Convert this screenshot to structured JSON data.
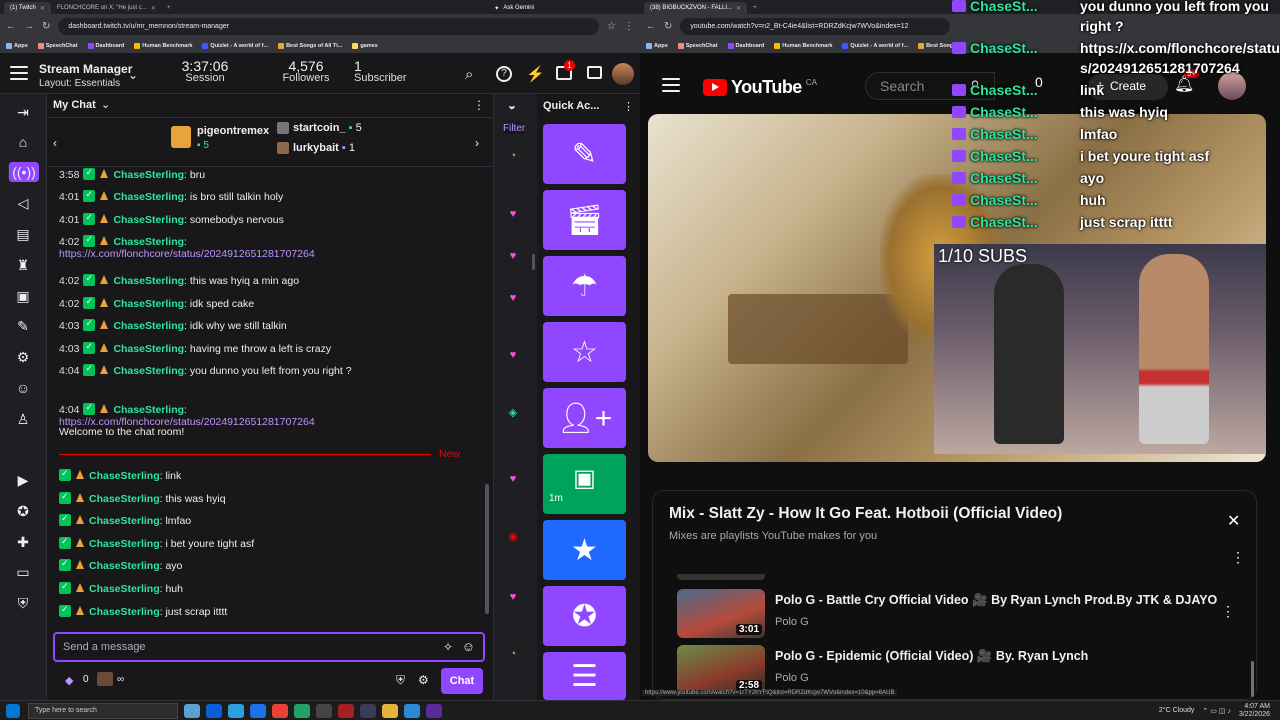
{
  "left_browser": {
    "tabs": [
      {
        "label": "(1) Twitch"
      },
      {
        "label": "FLONCHCORE on X: \"He just c..."
      }
    ],
    "ask_gemini": "Ask Gemini",
    "url": "dashboard.twitch.tv/u/mr_memnon/stream-manager",
    "bookmarks": [
      "Apps",
      "SpeechChat",
      "Dashboard",
      "Human Benchmark",
      "Quizlet - A world of f...",
      "Best Songs of All Ti...",
      "games"
    ]
  },
  "twitch": {
    "title": "Stream Manager",
    "layout": "Layout: Essentials",
    "session_value": "3:37:06",
    "session_label": "Session",
    "followers_value": "4,576",
    "followers_label": "Followers",
    "subs_value": "1",
    "subs_label": "Subscriber",
    "notif_count": "1",
    "chat_title": "My Chat",
    "gifters": [
      {
        "name": "pigeontremex",
        "count": "5"
      },
      {
        "name": "startcoin_",
        "count": "5"
      },
      {
        "name": "lurkybait",
        "count": "1"
      }
    ],
    "messages": [
      {
        "time": "3:58",
        "user": "ChaseSterling",
        "text": "bru"
      },
      {
        "time": "4:01",
        "user": "ChaseSterling",
        "text": "is bro still talkin holy"
      },
      {
        "time": "4:01",
        "user": "ChaseSterling",
        "text": "somebodys nervous"
      },
      {
        "time": "4:02",
        "user": "ChaseSterling",
        "text": "",
        "link": "https://x.com/flonchcore/status/2024912651281707264"
      },
      {
        "time": "4:02",
        "user": "ChaseSterling",
        "text": "this was hyiq a min ago"
      },
      {
        "time": "4:02",
        "user": "ChaseSterling",
        "text": "idk sped cake"
      },
      {
        "time": "4:03",
        "user": "ChaseSterling",
        "text": "idk why we still talkin"
      },
      {
        "time": "4:03",
        "user": "ChaseSterling",
        "text": "having me throw a left is crazy"
      },
      {
        "time": "4:04",
        "user": "ChaseSterling",
        "text": "you dunno you left from you right ?"
      },
      {
        "time": "4:04",
        "user": "ChaseSterling",
        "text": "",
        "link": "https://x.com/flonchcore/status/2024912651281707264"
      }
    ],
    "welcome": "Welcome to the chat room!",
    "new_label": "New",
    "new_messages": [
      {
        "user": "ChaseSterling",
        "text": "link"
      },
      {
        "user": "ChaseSterling",
        "text": "this was hyiq"
      },
      {
        "user": "ChaseSterling",
        "text": "lmfao"
      },
      {
        "user": "ChaseSterling",
        "text": "i bet youre tight asf"
      },
      {
        "user": "ChaseSterling",
        "text": "ayo"
      },
      {
        "user": "ChaseSterling",
        "text": "huh"
      },
      {
        "user": "ChaseSterling",
        "text": "just scrap itttt"
      }
    ],
    "input_placeholder": "Send a message",
    "points": "0",
    "infinity": "∞",
    "chat_button": "Chat",
    "quick_actions_title": "Quick Ac...",
    "filter": "Filter",
    "qa_timer": "1m",
    "colors": {
      "purple": "#9147ff",
      "green": "#00a35c",
      "blue": "#1f69ff",
      "name": "#2ee59d"
    }
  },
  "right_browser": {
    "tab": "(38) BIGBUCKZVON - FALLI...",
    "url": "youtube.com/watch?v=n2_Bt-C4ie4&list=RDRZdKcjw7WVo&index=12",
    "bookmarks": [
      "Apps",
      "SpeechChat",
      "Dashboard",
      "Human Benchmark",
      "Quizlet - A world of f...",
      "Best Songs..."
    ]
  },
  "youtube": {
    "country": "CA",
    "search_placeholder": "Search",
    "create": "Create",
    "notif": "9+",
    "video_overlay": "1/10 SUBS",
    "overlay_chat": [
      {
        "user": "ChaseSt...",
        "text": "you dunno you left from you"
      },
      {
        "user": "",
        "text": "right ?"
      },
      {
        "user": "ChaseSt...",
        "text": "https://x.com/flonchcore/statu"
      },
      {
        "user": "",
        "text": "s/2024912651281707264"
      },
      {
        "user": "ChaseSt...",
        "text": "link"
      },
      {
        "user": "ChaseSt...",
        "text": "this was hyiq"
      },
      {
        "user": "ChaseSt...",
        "text": "lmfao"
      },
      {
        "user": "ChaseSt...",
        "text": "i bet youre tight asf"
      },
      {
        "user": "ChaseSt...",
        "text": "ayo"
      },
      {
        "user": "ChaseSt...",
        "text": "huh"
      },
      {
        "user": "ChaseSt...",
        "text": "just scrap itttt"
      }
    ],
    "playlist_title": "Mix - Slatt Zy - How It Go Feat. Hotboii (Official Video)",
    "playlist_sub": "Mixes are playlists YouTube makes for you",
    "items": [
      {
        "title": "Polo G - Battle Cry Official Video 🎥 By Ryan Lynch Prod.By JTK & DJAYO",
        "channel": "Polo G",
        "duration": "3:01"
      },
      {
        "title": "Polo G - Epidemic (Official Video) 🎥 By. Ryan Lynch",
        "channel": "Polo G",
        "duration": "2:58"
      }
    ],
    "status_url": "https://www.youtube.com/watch?v=1rTY2hYFtQ&list=RDRZdKcjw7WVo&index=10&pp=8AUB"
  },
  "taskbar": {
    "search": "Type here to search",
    "weather": "2°C Cloudy",
    "time": "4:07 AM",
    "date": "3/22/2026"
  }
}
